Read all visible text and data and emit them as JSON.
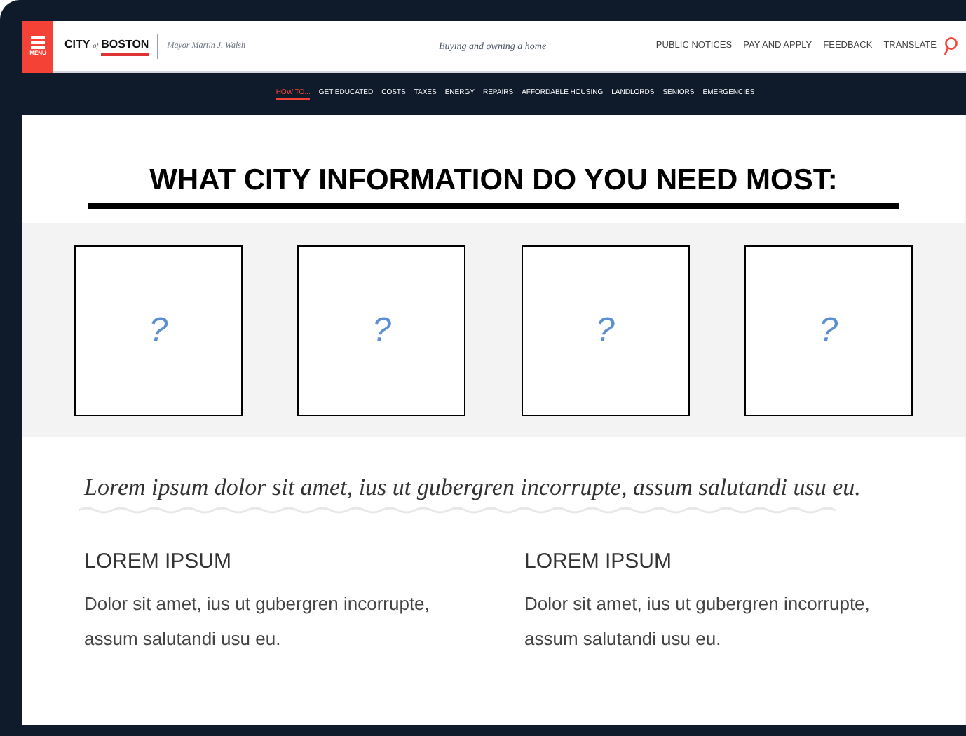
{
  "header": {
    "menu_label": "MENU",
    "logo": {
      "city": "CITY",
      "of": "of",
      "boston": "BOSTON"
    },
    "mayor": "Mayor Martin J. Walsh",
    "tagline": "Buying and owning a home",
    "links": [
      "PUBLIC NOTICES",
      "PAY AND APPLY",
      "FEEDBACK",
      "TRANSLATE"
    ]
  },
  "nav": [
    {
      "label": "HOW TO...",
      "selected": true
    },
    {
      "label": "GET EDUCATED",
      "selected": false
    },
    {
      "label": "COSTS",
      "selected": false
    },
    {
      "label": "TAXES",
      "selected": false
    },
    {
      "label": "ENERGY",
      "selected": false
    },
    {
      "label": "REPAIRS",
      "selected": false
    },
    {
      "label": "AFFORDABLE HOUSING",
      "selected": false
    },
    {
      "label": "LANDLORDS",
      "selected": false
    },
    {
      "label": "SENIORS",
      "selected": false
    },
    {
      "label": "EMERGENCIES",
      "selected": false
    }
  ],
  "heading": "WHAT CITY INFORMATION DO YOU NEED MOST:",
  "cards": [
    "?",
    "?",
    "?",
    "?"
  ],
  "intro": "Lorem ipsum dolor sit amet, ius ut gubergren incorrupte, assum salutandi usu eu.",
  "columns": [
    {
      "title": "LOREM IPSUM",
      "text": "Dolor sit amet, ius ut gubergren incorrupte, assum salutandi usu eu."
    },
    {
      "title": "LOREM IPSUM",
      "text": "Dolor sit amet, ius ut gubergren incorrupte, assum salutandi usu eu."
    }
  ]
}
